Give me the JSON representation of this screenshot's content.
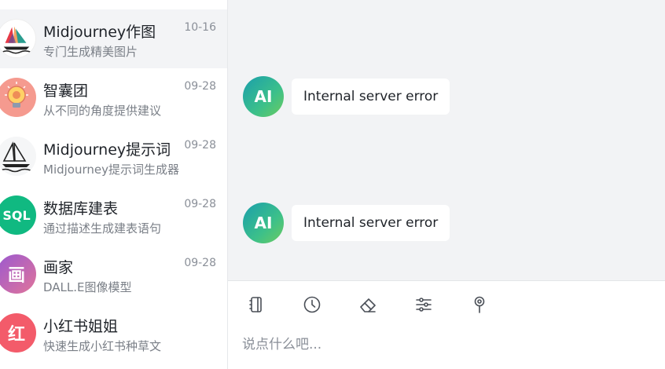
{
  "sidebar": {
    "items": [
      {
        "title": "Midjourney作图",
        "subtitle": "专门生成精美图片",
        "date": "10-16",
        "icon": "sailboat-color-icon",
        "active": true
      },
      {
        "title": "智囊团",
        "subtitle": "从不同的角度提供建议",
        "date": "09-28",
        "icon": "lightbulb-icon",
        "bg": "#f59a8f"
      },
      {
        "title": "Midjourney提示词",
        "subtitle": "Midjourney提示词生成器",
        "date": "09-28",
        "icon": "sailboat-icon"
      },
      {
        "title": "数据库建表",
        "subtitle": "通过描述生成建表语句",
        "date": "09-28",
        "avatar_text": "SQL",
        "bg": "#10b981"
      },
      {
        "title": "画家",
        "subtitle": "DALL.E图像模型",
        "date": "09-28",
        "avatar_text": "画",
        "bg": "#b56ad8"
      },
      {
        "title": "小红书姐姐",
        "subtitle": "快速生成小红书种草文",
        "date": "",
        "avatar_text": "红",
        "bg": "#f35b6a"
      }
    ]
  },
  "messages": [
    {
      "sender": "AI",
      "text": "Internal server error"
    },
    {
      "sender": "AI",
      "text": "Internal server error"
    }
  ],
  "composer": {
    "tools": [
      "notebook-icon",
      "clock-icon",
      "eraser-icon",
      "sliders-icon",
      "pin-icon"
    ],
    "placeholder": "说点什么吧..."
  },
  "colors": {
    "accent": "#10b981",
    "ai_gradient_start": "#1a9eac",
    "ai_gradient_end": "#6ccb5f"
  }
}
